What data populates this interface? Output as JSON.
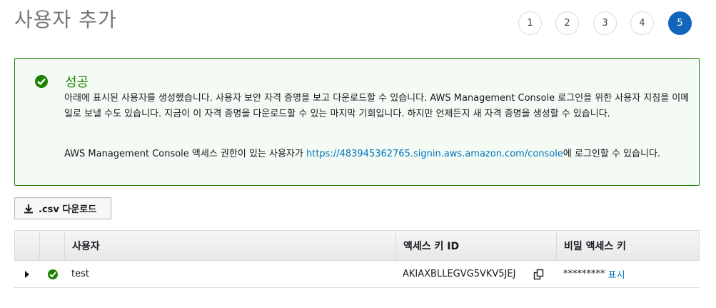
{
  "page": {
    "title": "사용자 추가"
  },
  "steps": [
    "1",
    "2",
    "3",
    "4",
    "5"
  ],
  "active_step": "5",
  "alert": {
    "icon": "check-circle-icon",
    "heading": "성공",
    "body": "아래에 표시된 사용자를 생성했습니다. 사용자 보안 자격 증명을 보고 다운로드할 수 있습니다. AWS Management Console 로그인을 위한 사용자 지침을 이메일로 보낼 수도 있습니다. 지금이 이 자격 증명을 다운로드할 수 있는 마지막 기회입니다. 하지만 언제든지 새 자격 증명을 생성할 수 있습니다.",
    "console_prefix": "AWS Management Console 액세스 권한이 있는 사용자가 ",
    "console_url": "https://483945362765.signin.aws.amazon.com/console",
    "console_suffix": "에 로그인할 수 있습니다."
  },
  "download_button": {
    "label": ".csv 다운로드",
    "icon": "download-icon"
  },
  "table": {
    "columns": [
      "사용자",
      "액세스 키 ID",
      "비밀 액세스 키"
    ],
    "rows": [
      {
        "status_icon": "check-circle-icon",
        "user": "test",
        "access_key_id": "AKIAXBLLEGVG5VKV5JEJ",
        "secret_masked": "*********",
        "show_label": "표시"
      }
    ]
  },
  "colors": {
    "success": "#1d8102",
    "accent": "#1166bb",
    "link": "#0073bb"
  }
}
